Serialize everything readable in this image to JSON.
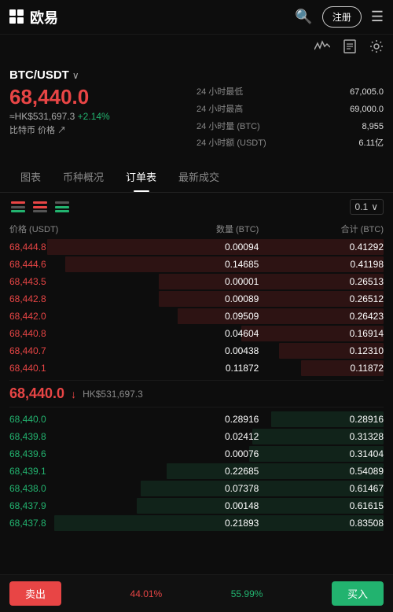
{
  "header": {
    "logo_text": "欧易",
    "register_label": "注册",
    "menu_icon": "☰",
    "search_icon": "🔍"
  },
  "sub_header": {
    "wave_icon": "〜",
    "doc_icon": "▣",
    "settings_icon": "⚙"
  },
  "ticker": {
    "pair": "BTC/USDT",
    "price": "68,440.0",
    "hk_price": "≈HK$531,697.3",
    "change_pct": "+2.14%",
    "btc_label": "比特币 价格 ↗",
    "stat_low_label": "24 小时最低",
    "stat_low_val": "67,005.0",
    "stat_high_label": "24 小时最高",
    "stat_high_val": "69,000.0",
    "stat_vol_btc_label": "24 小时量 (BTC)",
    "stat_vol_btc_val": "8,955",
    "stat_vol_usdt_label": "24 小时额 (USDT)",
    "stat_vol_usdt_val": "6.11亿"
  },
  "tabs": [
    {
      "label": "图表",
      "active": false
    },
    {
      "label": "币种概况",
      "active": false
    },
    {
      "label": "订单表",
      "active": true
    },
    {
      "label": "最新成交",
      "active": false
    }
  ],
  "orderbook": {
    "precision": "0.1",
    "col_price": "价格 (USDT)",
    "col_qty": "数量 (BTC)",
    "col_total": "合计 (BTC)",
    "sell_orders": [
      {
        "price": "68,444.8",
        "qty": "0.00094",
        "total": "0.41292",
        "bar_pct": 90
      },
      {
        "price": "68,444.6",
        "qty": "0.14685",
        "total": "0.41198",
        "bar_pct": 85
      },
      {
        "price": "68,443.5",
        "qty": "0.00001",
        "total": "0.26513",
        "bar_pct": 60
      },
      {
        "price": "68,442.8",
        "qty": "0.00089",
        "total": "0.26512",
        "bar_pct": 60
      },
      {
        "price": "68,442.0",
        "qty": "0.09509",
        "total": "0.26423",
        "bar_pct": 55
      },
      {
        "price": "68,440.8",
        "qty": "0.04604",
        "total": "0.16914",
        "bar_pct": 38
      },
      {
        "price": "68,440.7",
        "qty": "0.00438",
        "total": "0.12310",
        "bar_pct": 28
      },
      {
        "price": "68,440.1",
        "qty": "0.11872",
        "total": "0.11872",
        "bar_pct": 22
      }
    ],
    "middle_price": "68,440.0",
    "middle_hk": "HK$531,697.3",
    "buy_orders": [
      {
        "price": "68,440.0",
        "qty": "0.28916",
        "total": "0.28916",
        "bar_pct": 30
      },
      {
        "price": "68,439.8",
        "qty": "0.02412",
        "total": "0.31328",
        "bar_pct": 35
      },
      {
        "price": "68,439.6",
        "qty": "0.00076",
        "total": "0.31404",
        "bar_pct": 36
      },
      {
        "price": "68,439.1",
        "qty": "0.22685",
        "total": "0.54089",
        "bar_pct": 58
      },
      {
        "price": "68,438.0",
        "qty": "0.07378",
        "total": "0.61467",
        "bar_pct": 65
      },
      {
        "price": "68,437.9",
        "qty": "0.00148",
        "total": "0.61615",
        "bar_pct": 66
      },
      {
        "price": "68,437.8",
        "qty": "0.21893",
        "total": "0.83508",
        "bar_pct": 88
      }
    ]
  },
  "bottom_bar": {
    "sell_label": "卖出",
    "buy_label": "买入",
    "sell_pct": "44.01%",
    "buy_pct": "55.99%"
  }
}
